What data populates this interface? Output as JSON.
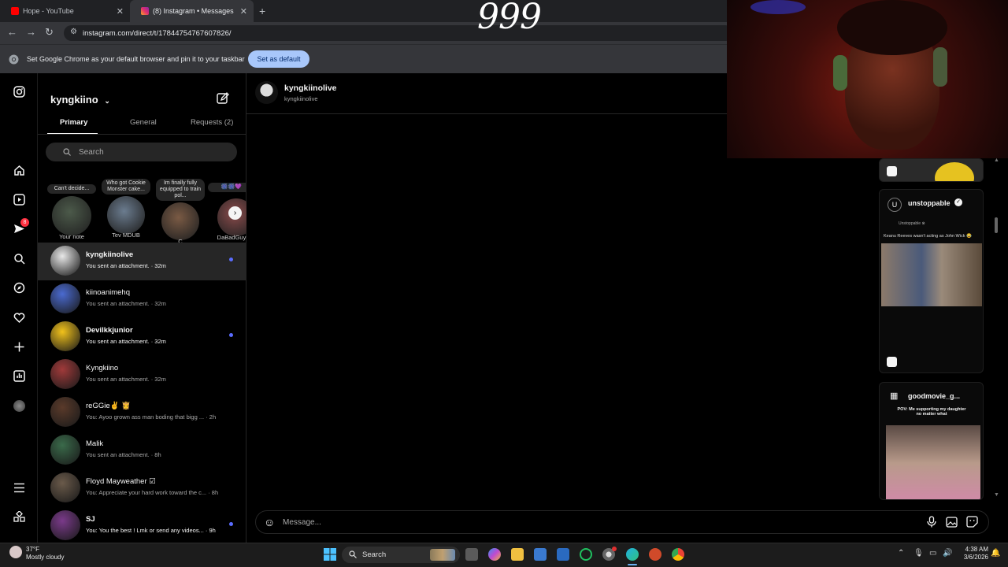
{
  "browser": {
    "tabs": [
      {
        "title": "Hope - YouTube",
        "favicon_color": "#ff0000"
      },
      {
        "title": "(8) Instagram • Messages",
        "favicon_color": "#e1306c"
      }
    ],
    "url": "instagram.com/direct/t/17844754767607826/",
    "infobar_text": "Set Google Chrome as your default browser and pin it to your taskbar",
    "infobar_button": "Set as default"
  },
  "overlay": {
    "score": "999"
  },
  "rail": {
    "notification_count": "8"
  },
  "dm": {
    "account": "kyngkiino",
    "tabs": [
      {
        "label": "Primary"
      },
      {
        "label": "General"
      },
      {
        "label": "Requests (2)"
      }
    ],
    "search_placeholder": "Search",
    "notes": [
      {
        "bubble": "Can't decide...",
        "name": "Your note",
        "color": "#4c5a4a"
      },
      {
        "bubble": "Who got Cookie Monster cake...",
        "name": "Tev MDUB",
        "color": "#6b7c8f"
      },
      {
        "bubble": "Im finally fully equipped to train pol...",
        "name": "C",
        "color": "#7a5a44"
      },
      {
        "bubble": "🎆🎆💜",
        "name": "DaBadGuy",
        "color": "#8a4b4b"
      }
    ],
    "conversations": [
      {
        "name": "kyngkiinolive",
        "msg": "You sent an attachment. · 32m",
        "unread": true,
        "selected": true,
        "color": "#e8e8e8"
      },
      {
        "name": "kiinoanimehq",
        "msg": "You sent an attachment. · 32m",
        "unread": false,
        "selected": false,
        "color": "#4a6ad0"
      },
      {
        "name": "Devilkkjunior",
        "msg": "You sent an attachment. · 32m",
        "unread": true,
        "selected": false,
        "color": "#f2c21b"
      },
      {
        "name": "Kyngkiino",
        "msg": "You sent an attachment. · 32m",
        "unread": false,
        "selected": false,
        "color": "#a03a3a"
      },
      {
        "name": "reGGie✌️ 👸",
        "msg": "You: Ayoo grown ass man boding that bigg ... · 2h",
        "unread": false,
        "selected": false,
        "color": "#5a3a2a"
      },
      {
        "name": "Malik",
        "msg": "You sent an attachment. · 8h",
        "unread": false,
        "selected": false,
        "color": "#3a6a4a"
      },
      {
        "name": "Floyd Mayweather ☑",
        "msg": "You: Appreciate your hard work toward the c... · 8h",
        "unread": false,
        "selected": false,
        "color": "#6a5a4a"
      },
      {
        "name": "SJ",
        "msg": "You: You the best ! Lmk or send any videos... · 9h",
        "unread": true,
        "selected": false,
        "color": "#7a3a8a"
      }
    ]
  },
  "chat": {
    "name": "kyngkiinolive",
    "username": "kyngkiinolive",
    "placeholder": "Message..."
  },
  "reels": [
    {
      "account": "unstoppable",
      "caption": "Keanu Reeves wasn't acting as John Wick 😂",
      "subhandle": "Unstoppable ⊗"
    },
    {
      "account": "goodmovie_g...",
      "caption": "POV: Me supporting my daughter no matter what"
    }
  ],
  "taskbar": {
    "temp": "37°F",
    "weather": "Mostly cloudy",
    "search": "Search",
    "time": "4:38 AM",
    "date": "3/6/2026"
  }
}
